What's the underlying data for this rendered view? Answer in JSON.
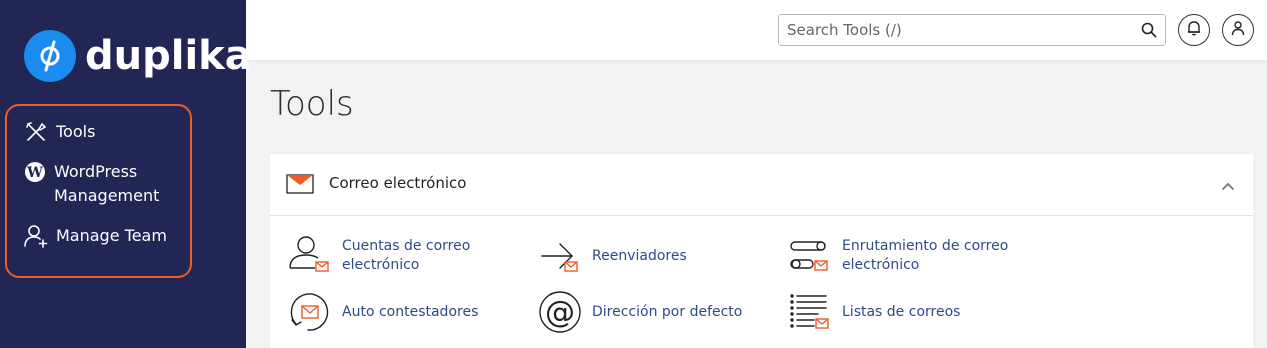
{
  "brand": {
    "name": "duplika",
    "accent": "#1a8cf0",
    "sidebar_bg": "#222654",
    "highlight": "#f05a28"
  },
  "sidebar": {
    "items": [
      {
        "label": "Tools",
        "icon": "tools-icon"
      },
      {
        "label": "WordPress Management",
        "icon": "wordpress-icon"
      },
      {
        "label": "Manage Team",
        "icon": "add-user-icon"
      }
    ]
  },
  "header": {
    "search_placeholder": "Search Tools (/)",
    "icons": [
      "bell-icon",
      "user-icon"
    ]
  },
  "main": {
    "title": "Tools",
    "section": {
      "title": "Correo electrónico",
      "icon": "envelope-icon",
      "tools": [
        {
          "label": "Cuentas de correo electrónico",
          "icon": "email-accounts-icon"
        },
        {
          "label": "Reenviadores",
          "icon": "forwarders-icon"
        },
        {
          "label": "Enrutamiento de correo electrónico",
          "icon": "email-routing-icon"
        },
        {
          "label": "Auto contestadores",
          "icon": "autoresponders-icon"
        },
        {
          "label": "Dirección por defecto",
          "icon": "default-address-icon"
        },
        {
          "label": "Listas de correos",
          "icon": "mailing-lists-icon"
        }
      ]
    }
  }
}
